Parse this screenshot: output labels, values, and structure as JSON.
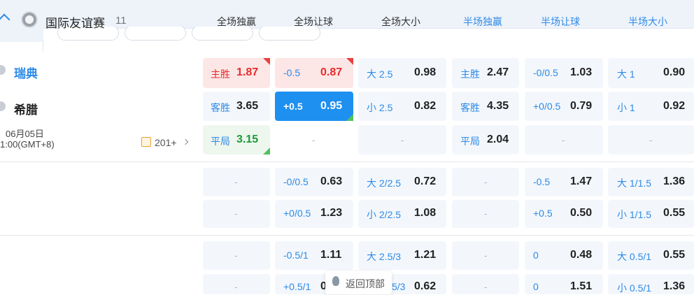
{
  "header": {
    "league": "国际友谊赛",
    "league_count": "11",
    "columns": [
      "全场独赢",
      "全场让球",
      "全场大小",
      "半场独赢",
      "半场让球",
      "半场大小"
    ]
  },
  "match": {
    "home": "瑞典",
    "away": "希腊",
    "date": "06月05日",
    "time": "1:00(GMT+8)",
    "more_count": "201+"
  },
  "rows": {
    "r1": {
      "ml_label": "主胜",
      "ml_val": "1.87",
      "hc_label": "-0.5",
      "hc_val": "0.87",
      "ou_label": "大 2.5",
      "ou_val": "0.98",
      "hml_label": "主胜",
      "hml_val": "2.47",
      "hhc_label": "-0/0.5",
      "hhc_val": "1.03",
      "hou_label": "大 1",
      "hou_val": "0.90"
    },
    "r2": {
      "ml_label": "客胜",
      "ml_val": "3.65",
      "hc_label": "+0.5",
      "hc_val": "0.95",
      "ou_label": "小 2.5",
      "ou_val": "0.82",
      "hml_label": "客胜",
      "hml_val": "4.35",
      "hhc_label": "+0/0.5",
      "hhc_val": "0.79",
      "hou_label": "小 1",
      "hou_val": "0.92"
    },
    "r3": {
      "ml_label": "平局",
      "ml_val": "3.15",
      "hml_label": "平局",
      "hml_val": "2.04"
    },
    "r4": {
      "hc_label": "-0/0.5",
      "hc_val": "0.63",
      "ou_label": "大 2/2.5",
      "ou_val": "0.72",
      "hhc_label": "-0.5",
      "hhc_val": "1.47",
      "hou_label": "大 1/1.5",
      "hou_val": "1.36"
    },
    "r5": {
      "hc_label": "+0/0.5",
      "hc_val": "1.23",
      "ou_label": "小 2/2.5",
      "ou_val": "1.08",
      "hhc_label": "+0.5",
      "hhc_val": "0.50",
      "hou_label": "小 1/1.5",
      "hou_val": "0.55"
    },
    "r6": {
      "hc_label": "-0.5/1",
      "hc_val": "1.11",
      "ou_label": "大 2.5/3",
      "ou_val": "1.21",
      "hhc_label": "0",
      "hhc_val": "0.48",
      "hou_label": "大 0.5/1",
      "hou_val": "0.55"
    },
    "r7": {
      "hc_label": "+0.5/1",
      "hc_val": "0",
      "ou_label": "5/3",
      "ou_val": "0.62",
      "hhc_label": "0",
      "hhc_val": "1.51",
      "hou_label": "小 0.5/1",
      "hou_val": "1.36"
    }
  },
  "dash": "-",
  "back_to_top": "返回顶部",
  "colors": {
    "accent": "#2d8ae6",
    "selected": "#1e90f0",
    "home": "#e62c2c",
    "draw": "#1e9a3c"
  }
}
